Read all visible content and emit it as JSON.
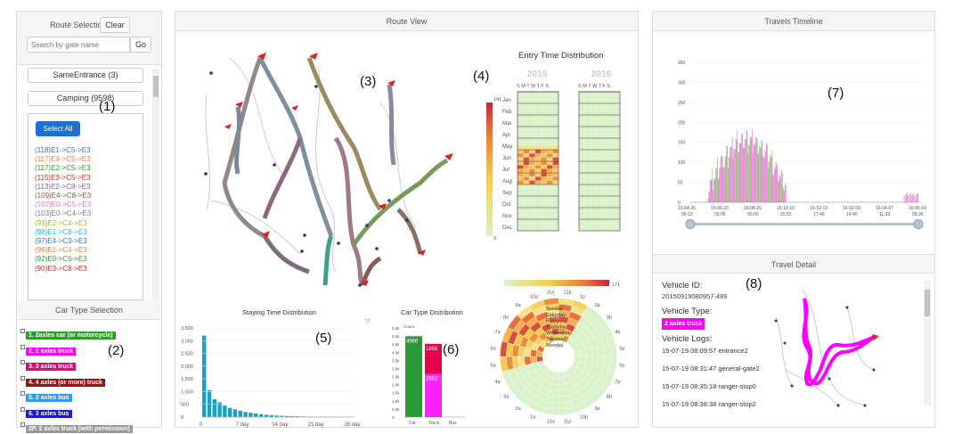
{
  "left": {
    "header": "Route Selection",
    "clear": "Clear",
    "search_placeholder": "Search by gate name",
    "go": "Go",
    "groups": [
      "SameEntrance (3)",
      "Camping (9598)"
    ],
    "select_all": "Select All",
    "routes": [
      {
        "label": "(118)E1->C5->E3",
        "color": "#3b6fb6"
      },
      {
        "label": "(117)E4->C5->E3",
        "color": "#f07d2a"
      },
      {
        "label": "(117)E2->C5->E3",
        "color": "#2f9a2f"
      },
      {
        "label": "(115)E3->C5->E3",
        "color": "#d62728"
      },
      {
        "label": "(113)E2->C8->E3",
        "color": "#8c5bb3"
      },
      {
        "label": "(109)E4->C8->E3",
        "color": "#8c564b"
      },
      {
        "label": "(107)E0->C5->E3",
        "color": "#e377c2"
      },
      {
        "label": "(103)E0->C4->E3",
        "color": "#7f7f7f"
      },
      {
        "label": "(99)E2->C4->E3",
        "color": "#aab520"
      },
      {
        "label": "(98)E1->C8->E3",
        "color": "#17becf"
      },
      {
        "label": "(97)E4->C3->E3",
        "color": "#3b6fb6"
      },
      {
        "label": "(96)E1->C4->E3",
        "color": "#f07d2a"
      },
      {
        "label": "(92)E0->C6->E3",
        "color": "#2f9a2f"
      },
      {
        "label": "(90)E3->C8->E3",
        "color": "#d62728"
      }
    ],
    "car_type_header": "Car Type Selection",
    "car_types": [
      {
        "label": "1. 2axles car (or motorcycle)",
        "color": "#2ca02c"
      },
      {
        "label": "2. 2 axles truck",
        "color": "#ff00ff"
      },
      {
        "label": "3. 3 axles truck",
        "color": "#e6007e"
      },
      {
        "label": "4. 4 axles (or more) truck",
        "color": "#a01010"
      },
      {
        "label": "5. 2 axles bus",
        "color": "#3399ee"
      },
      {
        "label": "6. 3 axles bus",
        "color": "#1a1acc"
      },
      {
        "label": "2P. 2 axles truck (with permission)",
        "color": "#999999"
      }
    ],
    "n1": "(1)",
    "n2": "(2)"
  },
  "mid": {
    "header": "Route View",
    "n3": "(3)",
    "n4": "(4)",
    "n5": "(5)",
    "n6": "(6)",
    "entry_title": "Entry Time Distribution",
    "years": [
      "2015",
      "2016"
    ],
    "dow": "S M T W T F S",
    "months": [
      "Jan",
      "Feb",
      "Mar",
      "Apr",
      "May",
      "Jun",
      "Jul",
      "Aug",
      "Sep",
      "Oct",
      "Nov",
      "Dec"
    ],
    "legend_max": "141",
    "legend_min": "0",
    "legend2_max": "171",
    "staying_title": "Staying Time Distribution",
    "stay_yticks": [
      "0",
      "500",
      "1,000",
      "1,500",
      "2,000",
      "2,500",
      "3,000",
      "3,500"
    ],
    "stay_xticks": [
      "0",
      "7 day",
      "14 day",
      "21 day",
      "28 day"
    ],
    "cartype_title": "Car Type Distribution",
    "cartype_count": "Count",
    "cartype_yticks": [
      "0",
      "0.5k",
      "1.0k",
      "1.5k",
      "2.0k",
      "2.5k",
      "3.0k",
      "3.5k",
      "4.0k",
      "4.5k",
      "5.0k",
      "5.5k"
    ],
    "cartype_xlabels": [
      "Car",
      "Truck",
      "Bus"
    ],
    "car_val": "4986",
    "truck_val1": "1856",
    "truck_val2": "2662",
    "days": [
      "Sunday",
      "Saturday",
      "Friday",
      "Thursday",
      "Wednesday",
      "Tuesday",
      "Monday"
    ],
    "hours": [
      "12p",
      "1p",
      "2p",
      "3p",
      "4p",
      "5p",
      "6p",
      "7p",
      "8p",
      "9p",
      "10p",
      "11p",
      "12a",
      "1a",
      "2a",
      "3a",
      "4a",
      "5a",
      "6a",
      "7a",
      "8a",
      "9a",
      "10a",
      "11a"
    ]
  },
  "right": {
    "timeline_header": "Travels Timeline",
    "n7": "(7)",
    "tl_yticks": [
      "0",
      "50",
      "100",
      "150",
      "200",
      "250",
      "300",
      "350"
    ],
    "tl_xticks": [
      [
        "15-04-26",
        "06:13"
      ],
      [
        "15-06-23",
        "03:06"
      ],
      [
        "15-08-20",
        "00:00"
      ],
      [
        "15-10-16",
        "20:53"
      ],
      [
        "15-12-13",
        "17:46"
      ],
      [
        "16-02-09",
        "14:40"
      ],
      [
        "16-04-07",
        "11:33"
      ],
      [
        "16-06-04",
        "08:26"
      ]
    ],
    "detail_header": "Travel Detail",
    "n8": "(8)",
    "vid_label": "Vehicle ID:",
    "vid": "20150919080957-489",
    "vtype_label": "Vehicle Type:",
    "vtype": "2 axles truck",
    "vlog_label": "Vehicle Logs:",
    "logs": [
      "15-07-19 08:09:57 entrance2",
      "15-07-19 08:31:47 general-gate2",
      "15-07-19 08:35:18 ranger-stop0",
      "15-07-19 08:38:38 ranger-stop2"
    ]
  },
  "chart_data": [
    {
      "type": "bar",
      "title": "Staying Time Distribution",
      "xlabel": "",
      "ylabel": "",
      "ylim": [
        0,
        3500
      ],
      "x": [
        0,
        1,
        2,
        3,
        4,
        5,
        6,
        7,
        8,
        9,
        10,
        11,
        12,
        13,
        14,
        15,
        16,
        17,
        18,
        19,
        20,
        21,
        22,
        23,
        24,
        25,
        26,
        27,
        28,
        29
      ],
      "values": [
        3200,
        1050,
        700,
        580,
        450,
        360,
        300,
        250,
        200,
        170,
        140,
        110,
        90,
        75,
        60,
        50,
        42,
        35,
        30,
        25,
        20,
        18,
        15,
        12,
        10,
        8,
        7,
        6,
        5,
        4
      ]
    },
    {
      "type": "bar",
      "title": "Car Type Distribution",
      "categories": [
        "Car",
        "Truck",
        "Bus"
      ],
      "series": [
        {
          "values": [
            4986,
            1856,
            0
          ]
        },
        {
          "values": [
            0,
            2662,
            0
          ]
        }
      ],
      "ylim": [
        0,
        5500
      ]
    },
    {
      "type": "line",
      "title": "Travels Timeline",
      "ylim": [
        0,
        350
      ]
    }
  ]
}
